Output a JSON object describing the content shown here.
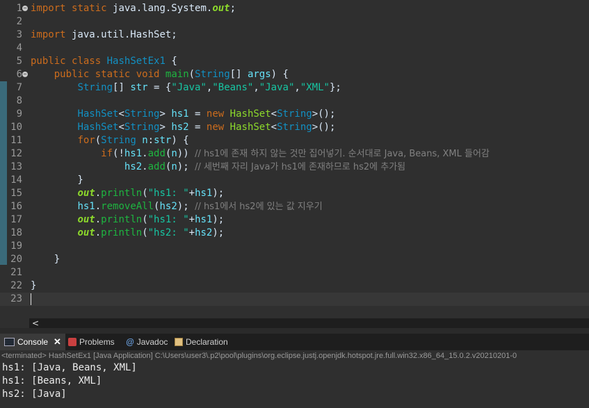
{
  "code_lines": [
    {
      "n": "1",
      "fold": true,
      "parts": [
        [
          "k",
          "import"
        ],
        [
          "o",
          " "
        ],
        [
          "k",
          "static"
        ],
        [
          "o",
          " java.lang.System."
        ],
        [
          "si",
          "out"
        ],
        [
          "o",
          ";"
        ]
      ]
    },
    {
      "n": "2",
      "parts": []
    },
    {
      "n": "3",
      "parts": [
        [
          "k",
          "import"
        ],
        [
          "o",
          " java.util.HashSet;"
        ]
      ]
    },
    {
      "n": "4",
      "parts": []
    },
    {
      "n": "5",
      "parts": [
        [
          "k",
          "public"
        ],
        [
          "o",
          " "
        ],
        [
          "k",
          "class"
        ],
        [
          "o",
          " "
        ],
        [
          "t",
          "HashSetEx1"
        ],
        [
          "o",
          " {"
        ]
      ]
    },
    {
      "n": "6",
      "fold": true,
      "parts": [
        [
          "o",
          "    "
        ],
        [
          "k",
          "public"
        ],
        [
          "o",
          " "
        ],
        [
          "k",
          "static"
        ],
        [
          "o",
          " "
        ],
        [
          "k",
          "void"
        ],
        [
          "o",
          " "
        ],
        [
          "m",
          "main"
        ],
        [
          "o",
          "("
        ],
        [
          "t",
          "String"
        ],
        [
          "o",
          "[] "
        ],
        [
          "v",
          "args"
        ],
        [
          "o",
          ") {"
        ]
      ]
    },
    {
      "n": "7",
      "parts": [
        [
          "o",
          "        "
        ],
        [
          "t",
          "String"
        ],
        [
          "o",
          "[] "
        ],
        [
          "v",
          "str"
        ],
        [
          "o",
          " = {"
        ],
        [
          "s",
          "\"Java\""
        ],
        [
          "o",
          ","
        ],
        [
          "s",
          "\"Beans\""
        ],
        [
          "o",
          ","
        ],
        [
          "s",
          "\"Java\""
        ],
        [
          "o",
          ","
        ],
        [
          "s",
          "\"XML\""
        ],
        [
          "o",
          "};"
        ]
      ]
    },
    {
      "n": "8",
      "parts": []
    },
    {
      "n": "9",
      "parts": [
        [
          "o",
          "        "
        ],
        [
          "t",
          "HashSet"
        ],
        [
          "o",
          "<"
        ],
        [
          "t",
          "String"
        ],
        [
          "o",
          "> "
        ],
        [
          "v",
          "hs1"
        ],
        [
          "o",
          " = "
        ],
        [
          "k",
          "new"
        ],
        [
          "o",
          " "
        ],
        [
          "f",
          "HashSet"
        ],
        [
          "o",
          "<"
        ],
        [
          "t",
          "String"
        ],
        [
          "o",
          ">();"
        ]
      ]
    },
    {
      "n": "10",
      "parts": [
        [
          "o",
          "        "
        ],
        [
          "t",
          "HashSet"
        ],
        [
          "o",
          "<"
        ],
        [
          "t",
          "String"
        ],
        [
          "o",
          "> "
        ],
        [
          "v",
          "hs2"
        ],
        [
          "o",
          " = "
        ],
        [
          "k",
          "new"
        ],
        [
          "o",
          " "
        ],
        [
          "f",
          "HashSet"
        ],
        [
          "o",
          "<"
        ],
        [
          "t",
          "String"
        ],
        [
          "o",
          ">();"
        ]
      ]
    },
    {
      "n": "11",
      "parts": [
        [
          "o",
          "        "
        ],
        [
          "k",
          "for"
        ],
        [
          "o",
          "("
        ],
        [
          "t",
          "String"
        ],
        [
          "o",
          " "
        ],
        [
          "v",
          "n"
        ],
        [
          "o",
          ":"
        ],
        [
          "v",
          "str"
        ],
        [
          "o",
          ") {"
        ]
      ]
    },
    {
      "n": "12",
      "parts": [
        [
          "o",
          "            "
        ],
        [
          "k",
          "if"
        ],
        [
          "o",
          "(!"
        ],
        [
          "v",
          "hs1"
        ],
        [
          "o",
          "."
        ],
        [
          "m",
          "add"
        ],
        [
          "o",
          "("
        ],
        [
          "v",
          "n"
        ],
        [
          "o",
          ")) "
        ],
        [
          "c",
          "// hs1에 존재 하지 않는 것만 집어넣기. 순서대로 Java, Beans, XML 들어감"
        ]
      ]
    },
    {
      "n": "13",
      "parts": [
        [
          "o",
          "                "
        ],
        [
          "v",
          "hs2"
        ],
        [
          "o",
          "."
        ],
        [
          "m",
          "add"
        ],
        [
          "o",
          "("
        ],
        [
          "v",
          "n"
        ],
        [
          "o",
          "); "
        ],
        [
          "c",
          "// 세번째 자리 Java가 hs1에 존재하므로 hs2에 추가됨"
        ]
      ]
    },
    {
      "n": "14",
      "parts": [
        [
          "o",
          "        }"
        ]
      ]
    },
    {
      "n": "15",
      "parts": [
        [
          "o",
          "        "
        ],
        [
          "si",
          "out"
        ],
        [
          "o",
          "."
        ],
        [
          "m",
          "println"
        ],
        [
          "o",
          "("
        ],
        [
          "s",
          "\"hs1: \""
        ],
        [
          "o",
          "+"
        ],
        [
          "v",
          "hs1"
        ],
        [
          "o",
          ");"
        ]
      ]
    },
    {
      "n": "16",
      "parts": [
        [
          "o",
          "        "
        ],
        [
          "v",
          "hs1"
        ],
        [
          "o",
          "."
        ],
        [
          "m",
          "removeAll"
        ],
        [
          "o",
          "("
        ],
        [
          "v",
          "hs2"
        ],
        [
          "o",
          "); "
        ],
        [
          "c",
          "// hs1에서 hs2에 있는 값 지우기"
        ]
      ]
    },
    {
      "n": "17",
      "parts": [
        [
          "o",
          "        "
        ],
        [
          "si",
          "out"
        ],
        [
          "o",
          "."
        ],
        [
          "m",
          "println"
        ],
        [
          "o",
          "("
        ],
        [
          "s",
          "\"hs1: \""
        ],
        [
          "o",
          "+"
        ],
        [
          "v",
          "hs1"
        ],
        [
          "o",
          ");"
        ]
      ]
    },
    {
      "n": "18",
      "parts": [
        [
          "o",
          "        "
        ],
        [
          "si",
          "out"
        ],
        [
          "o",
          "."
        ],
        [
          "m",
          "println"
        ],
        [
          "o",
          "("
        ],
        [
          "s",
          "\"hs2: \""
        ],
        [
          "o",
          "+"
        ],
        [
          "v",
          "hs2"
        ],
        [
          "o",
          ");"
        ]
      ]
    },
    {
      "n": "19",
      "parts": []
    },
    {
      "n": "20",
      "parts": [
        [
          "o",
          "    }"
        ]
      ]
    },
    {
      "n": "21",
      "parts": []
    },
    {
      "n": "22",
      "parts": [
        [
          "o",
          "}"
        ]
      ]
    },
    {
      "n": "23",
      "current": true,
      "cursor": true,
      "parts": []
    }
  ],
  "scroll": {
    "left_arrow": "<"
  },
  "tabs": [
    {
      "label": "Console",
      "icon": "console-icon",
      "active": true,
      "closable": true,
      "close_glyph": "✕"
    },
    {
      "label": "Problems",
      "icon": "problems-icon"
    },
    {
      "label": "Javadoc",
      "icon": "javadoc-icon",
      "glyph": "@"
    },
    {
      "label": "Declaration",
      "icon": "declaration-icon"
    }
  ],
  "console": {
    "header": "<terminated> HashSetEx1 [Java Application] C:\\Users\\user3\\.p2\\pool\\plugins\\org.eclipse.justj.openjdk.hotspot.jre.full.win32.x86_64_15.0.2.v20210201-0",
    "output": [
      "hs1: [Java, Beans, XML]",
      "hs1: [Beans, XML]",
      "hs2: [Java]"
    ]
  }
}
